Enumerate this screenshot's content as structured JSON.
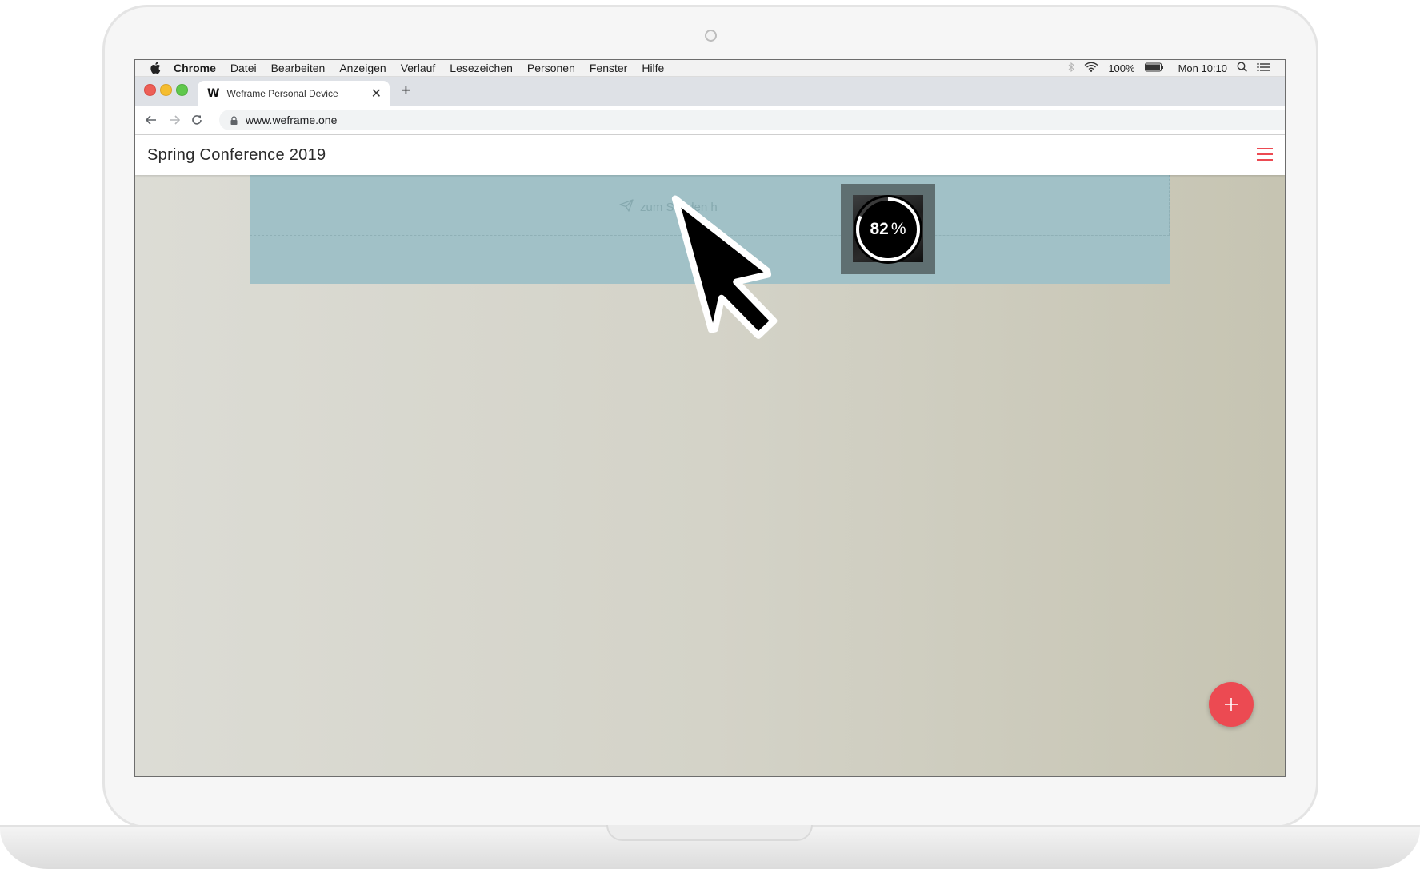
{
  "menubar": {
    "app_name": "Chrome",
    "items": [
      "Datei",
      "Bearbeiten",
      "Anzeigen",
      "Verlauf",
      "Lesezeichen",
      "Personen",
      "Fenster",
      "Hilfe"
    ],
    "battery": "100%",
    "clock": "Mon 10:10",
    "icons": [
      "apple-icon",
      "bluetooth-icon",
      "wifi-icon",
      "battery-icon",
      "spotlight-search-icon",
      "notification-center-icon"
    ]
  },
  "browser": {
    "tab": {
      "favicon": "W",
      "title": "Weframe Personal Device"
    },
    "url": "www.weframe.one"
  },
  "app": {
    "title": "Spring Conference 2019",
    "dropzone_hint": "zum Senden h",
    "upload": {
      "progress_value": "82",
      "progress_unit": "%",
      "progress_fraction": 0.82
    },
    "accent_color": "#ec4a52"
  }
}
